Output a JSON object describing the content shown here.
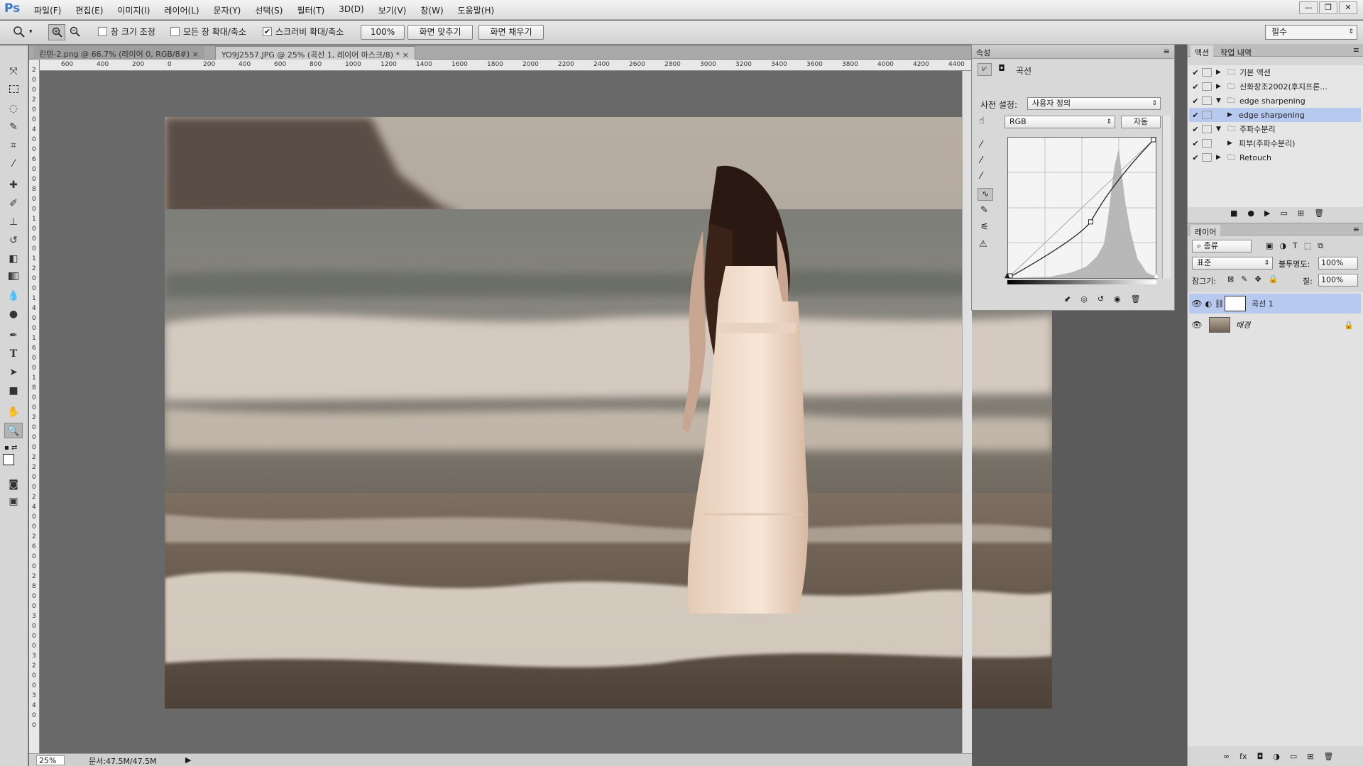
{
  "app": {
    "logo": "Ps"
  },
  "menu": [
    "파일(F)",
    "편집(E)",
    "이미지(I)",
    "레이어(L)",
    "문자(Y)",
    "선택(S)",
    "필터(T)",
    "3D(D)",
    "보기(V)",
    "창(W)",
    "도움말(H)"
  ],
  "window_controls": [
    "—",
    "❐",
    "✕"
  ],
  "options": {
    "resize_windows": "창 크기 조정",
    "zoom_all": "모든 창 확대/축소",
    "scrubby_zoom": "스크러비 확대/축소",
    "zoom_value": "100%",
    "fit_screen": "화면 맞추기",
    "fill_screen": "화면 채우기",
    "workspace": "필수"
  },
  "tabs": [
    {
      "label": "린텐-2.png @ 66.7% (레이어 0, RGB/8#)",
      "close": "×"
    },
    {
      "label": "YO9J2557.JPG @ 25% (곡선 1, 레이어 마스크/8) *",
      "close": "×"
    }
  ],
  "ruler": {
    "h": [
      "600",
      "400",
      "200",
      "0",
      "200",
      "400",
      "600",
      "800",
      "1000",
      "1200",
      "1400",
      "1600",
      "1800",
      "2000",
      "2200",
      "2400",
      "2600",
      "2800",
      "3000",
      "3200",
      "3400",
      "3600",
      "3800",
      "4000",
      "4200",
      "4400"
    ],
    "v": [
      "2",
      "0",
      "0",
      "2",
      "0",
      "0",
      "4",
      "0",
      "0",
      "6",
      "0",
      "0",
      "8",
      "0",
      "0",
      "1",
      "0",
      "0",
      "0",
      "1",
      "2",
      "0",
      "0",
      "1",
      "4",
      "0",
      "0",
      "1",
      "6",
      "0",
      "0",
      "1",
      "8",
      "0",
      "0",
      "2",
      "0",
      "0",
      "0",
      "2",
      "2",
      "0",
      "0",
      "2",
      "4",
      "0",
      "0",
      "2",
      "6",
      "0",
      "0",
      "2",
      "8",
      "0",
      "0",
      "3",
      "0",
      "0",
      "0",
      "3",
      "2",
      "0",
      "0",
      "3",
      "4",
      "0",
      "0"
    ]
  },
  "status": {
    "zoom": "25%",
    "doc": "문서:47.5M/47.5M",
    "arrow": "▶"
  },
  "properties": {
    "panel_tab": "속성",
    "title": "곡선",
    "preset_label": "사전 설정:",
    "preset_value": "사용자 정의",
    "channel": "RGB",
    "auto_button": "자동",
    "curve_points": [
      [
        0,
        0
      ],
      [
        0.56,
        0.4
      ],
      [
        1,
        1
      ]
    ]
  },
  "actions": {
    "tabs": [
      "액션",
      "작업 내역"
    ],
    "items": [
      {
        "label": "기본 액션",
        "check": "✔",
        "expanded": false,
        "indent": 0
      },
      {
        "label": "신화창조2002(후지프론...",
        "check": "✔",
        "expanded": false,
        "indent": 0
      },
      {
        "label": "edge sharpening",
        "check": "✔",
        "expanded": true,
        "indent": 0
      },
      {
        "label": "edge sharpening",
        "check": "✔",
        "expanded": false,
        "indent": 1,
        "selected": true
      },
      {
        "label": "주파수분리",
        "check": "✔",
        "expanded": true,
        "indent": 0
      },
      {
        "label": "피부(주파수분리)",
        "check": "✔",
        "expanded": false,
        "indent": 1
      },
      {
        "label": "Retouch",
        "check": "✔",
        "expanded": false,
        "indent": 0
      }
    ]
  },
  "layers": {
    "tab": "레이어",
    "filter": "종류",
    "blend_mode": "표준",
    "opacity_label": "불투명도:",
    "opacity": "100%",
    "lock_label": "잠그기:",
    "fill_label": "칠:",
    "fill": "100%",
    "items": [
      {
        "name": "곡선 1",
        "selected": true
      },
      {
        "name": "배경",
        "selected": false
      }
    ],
    "bottom_icons": [
      "∞",
      "fx",
      "◘",
      "◑",
      "▭",
      "⊞",
      "🗑"
    ]
  },
  "colors": {
    "accent": "#3b79c4",
    "selection": "#b8c9ef"
  }
}
